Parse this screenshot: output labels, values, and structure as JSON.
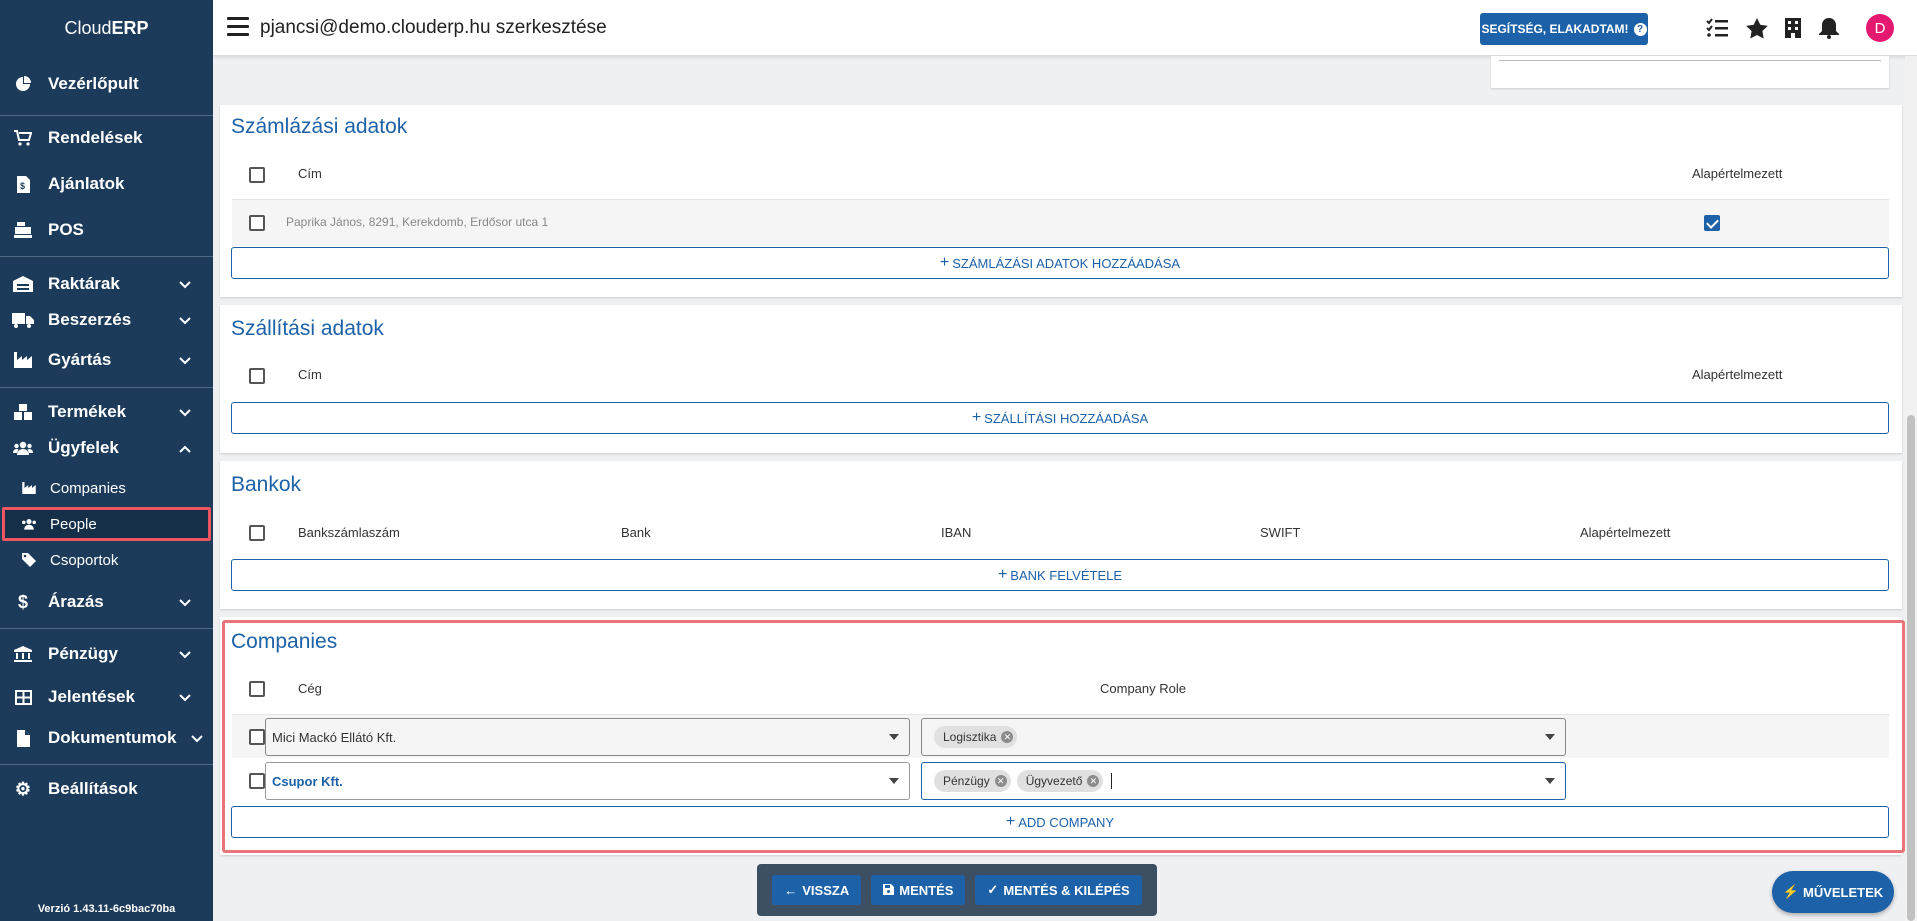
{
  "brand": {
    "prefix": "Cloud",
    "suffix": "ERP"
  },
  "header": {
    "title": "pjancsi@demo.clouderp.hu szerkesztése",
    "help_label": "SEGÍTSÉG, ELAKADTAM!",
    "avatar_initial": "D"
  },
  "sidebar": {
    "items": [
      {
        "label": "Vezérlőpult",
        "icon": "dashboard-icon"
      },
      {
        "label": "Rendelések",
        "icon": "cart-icon"
      },
      {
        "label": "Ajánlatok",
        "icon": "document-dollar-icon"
      },
      {
        "label": "POS",
        "icon": "cash-register-icon"
      },
      {
        "label": "Raktárak",
        "icon": "warehouse-icon"
      },
      {
        "label": "Beszerzés",
        "icon": "truck-icon"
      },
      {
        "label": "Gyártás",
        "icon": "factory-icon"
      },
      {
        "label": "Termékek",
        "icon": "boxes-icon"
      },
      {
        "label": "Ügyfelek",
        "icon": "users-icon"
      },
      {
        "label": "Árazás",
        "icon": "dollar-icon"
      },
      {
        "label": "Pénzügy",
        "icon": "bank-icon"
      },
      {
        "label": "Jelentések",
        "icon": "table-icon"
      },
      {
        "label": "Dokumentumok",
        "icon": "file-icon"
      },
      {
        "label": "Beállítások",
        "icon": "gear-icon"
      }
    ],
    "subitems": [
      {
        "label": "Companies",
        "icon": "factory-icon"
      },
      {
        "label": "People",
        "icon": "users-icon"
      },
      {
        "label": "Csoportok",
        "icon": "tags-icon"
      }
    ],
    "version": "Verzió 1.43.11-6c9bac70ba"
  },
  "billing": {
    "title": "Számlázási adatok",
    "col_address": "Cím",
    "col_default": "Alapértelmezett",
    "row_address": "Paprika János, 8291, Kerekdomb, Erdősor utca 1",
    "add_label": "SZÁMLÁZÁSI ADATOK HOZZÁADÁSA"
  },
  "shipping": {
    "title": "Szállítási adatok",
    "col_address": "Cím",
    "col_default": "Alapértelmezett",
    "add_label": "SZÁLLÍTÁSI HOZZÁADÁSA"
  },
  "banks": {
    "title": "Bankok",
    "col_account": "Bankszámlaszám",
    "col_bank": "Bank",
    "col_iban": "IBAN",
    "col_swift": "SWIFT",
    "col_default": "Alapértelmezett",
    "add_label": "BANK FELVÉTELE"
  },
  "companies": {
    "title": "Companies",
    "col_company": "Cég",
    "col_role": "Company Role",
    "rows": [
      {
        "company": "Mici Mackó Ellátó Kft.",
        "roles": [
          "Logisztika"
        ]
      },
      {
        "company": "Csupor Kft.",
        "roles": [
          "Pénzügy",
          "Ügyvezető"
        ]
      }
    ],
    "add_label": "ADD COMPANY"
  },
  "bottom_bar": {
    "back_label": "VISSZA",
    "save_label": "MENTÉS",
    "save_exit_label": "MENTÉS & KILÉPÉS"
  },
  "fab_label": "MŰVELETEK",
  "colors": {
    "accent": "#1d61a8",
    "sidebar": "#1c3b5a",
    "highlight": "#f0565f"
  }
}
